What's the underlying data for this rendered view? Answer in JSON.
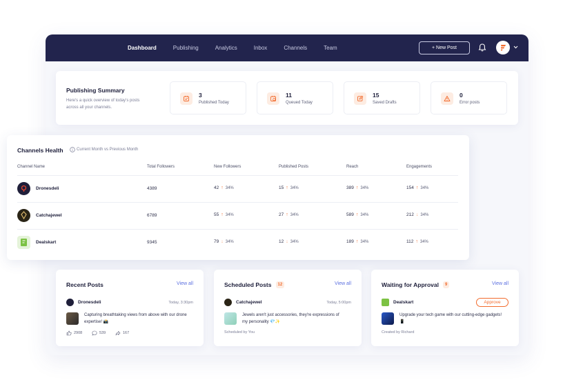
{
  "nav": {
    "items": [
      "Dashboard",
      "Publishing",
      "Analytics",
      "Inbox",
      "Channels",
      "Team"
    ],
    "new_post": "+ New Post"
  },
  "summary": {
    "title": "Publishing Summary",
    "subtitle": "Here's a quick overview of today's posts across all your channels.",
    "stats": [
      {
        "value": "3",
        "label": "Published Today",
        "icon": "calendar-check-icon"
      },
      {
        "value": "11",
        "label": "Queued Today",
        "icon": "queue-calendar-icon"
      },
      {
        "value": "15",
        "label": "Saved Drafts",
        "icon": "edit-icon"
      },
      {
        "value": "0",
        "label": "Error posts",
        "icon": "warning-icon"
      }
    ]
  },
  "health": {
    "title": "Channels Health",
    "subtitle": "Current Month vs Previous Month",
    "columns": [
      "Channel Name",
      "Total Followers",
      "New Followers",
      "Published Posts",
      "Reach",
      "Engagements"
    ],
    "rows": [
      {
        "name": "Dronesdeli",
        "total_followers": "4389",
        "new_followers": "42",
        "new_followers_pct": "34%",
        "new_followers_dir": "up",
        "published": "15",
        "published_pct": "34%",
        "published_dir": "up",
        "reach": "389",
        "reach_pct": "34%",
        "reach_dir": "up",
        "engagements": "154",
        "engagements_pct": "34%",
        "engagements_dir": "up"
      },
      {
        "name": "Catchajewel",
        "total_followers": "6789",
        "new_followers": "55",
        "new_followers_pct": "34%",
        "new_followers_dir": "up",
        "published": "27",
        "published_pct": "34%",
        "published_dir": "up",
        "reach": "589",
        "reach_pct": "34%",
        "reach_dir": "up",
        "engagements": "212",
        "engagements_pct": "34%",
        "engagements_dir": "down"
      },
      {
        "name": "Dealskart",
        "total_followers": "9345",
        "new_followers": "79",
        "new_followers_pct": "34%",
        "new_followers_dir": "down",
        "published": "12",
        "published_pct": "34%",
        "published_dir": "down",
        "reach": "189",
        "reach_pct": "34%",
        "reach_dir": "up",
        "engagements": "112",
        "engagements_pct": "34%",
        "engagements_dir": "up"
      }
    ]
  },
  "recent": {
    "title": "Recent Posts",
    "view_all": "View all",
    "author": "Dronesdeli",
    "time": "Today, 3:30pm",
    "text": "Capturing breathtaking views from above with our drone expertise! 📸",
    "likes": "2908",
    "comments": "539",
    "shares": "167"
  },
  "scheduled": {
    "title": "Scheduled Posts",
    "count": "12",
    "view_all": "View all",
    "author": "Catchajewel",
    "time": "Today, 5:00pm",
    "text": "Jewels aren't just accessories, they're expressions of my personality 💎✨",
    "footer": "Scheduled by You"
  },
  "approval": {
    "title": "Waiting for Approval",
    "count": "9",
    "view_all": "View all",
    "author": "Dealskart",
    "approve": "Approve",
    "text": "Upgrade your tech game with our cutting-edge gadgets! 📱",
    "footer": "Created by Richard"
  },
  "colors": {
    "navbar": "#22244d",
    "accent": "#f26b2d",
    "link": "#5b6fe0"
  }
}
